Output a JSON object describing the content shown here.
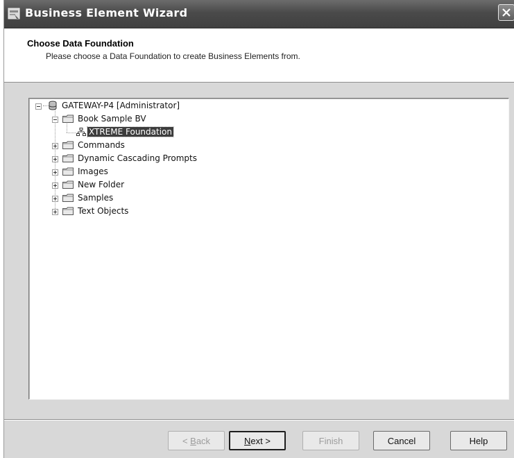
{
  "window": {
    "title": "Business Element Wizard"
  },
  "header": {
    "title": "Choose Data Foundation",
    "subtitle": "Please choose a Data Foundation to create Business Elements from."
  },
  "tree": {
    "root": "GATEWAY-P4 [Administrator]",
    "book": "Book Sample BV",
    "foundation": "XTREME Foundation",
    "folders": [
      "Commands",
      "Dynamic Cascading Prompts",
      "Images",
      "New Folder",
      "Samples",
      "Text Objects"
    ]
  },
  "buttons": {
    "back_prefix": "< ",
    "back_key": "B",
    "back_rest": "ack",
    "next_key": "N",
    "next_rest": "ext >",
    "finish": "Finish",
    "cancel": "Cancel",
    "help": "Help"
  },
  "icons": {
    "app": "wizard-window-icon",
    "close": "close-icon",
    "server": "database-server-icon",
    "folder": "folder-icon",
    "foundation": "data-foundation-icon"
  }
}
